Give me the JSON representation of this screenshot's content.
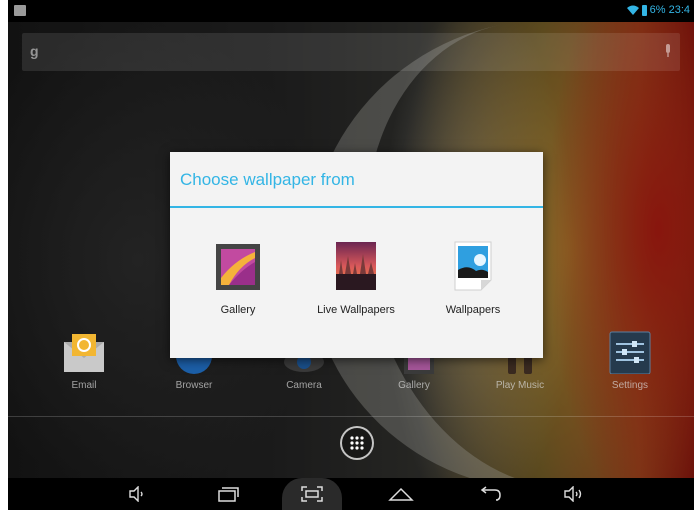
{
  "status_bar": {
    "battery_text": "6%",
    "time": "23:4"
  },
  "search": {
    "google_glyph": "g",
    "mic_icon": "mic-icon"
  },
  "dock": {
    "items": [
      {
        "label": "Email",
        "icon": "email-icon"
      },
      {
        "label": "Browser",
        "icon": "browser-icon"
      },
      {
        "label": "Camera",
        "icon": "camera-icon"
      },
      {
        "label": "Gallery",
        "icon": "gallery-icon"
      },
      {
        "label": "Play Music",
        "icon": "headphones-icon"
      },
      {
        "label": "Settings",
        "icon": "settings-icon"
      }
    ]
  },
  "dialog": {
    "title": "Choose wallpaper from",
    "options": [
      {
        "label": "Gallery",
        "icon": "gallery-icon"
      },
      {
        "label": "Live Wallpapers",
        "icon": "live-wallpapers-icon"
      },
      {
        "label": "Wallpapers",
        "icon": "wallpapers-icon"
      }
    ]
  },
  "nav": {
    "buttons": [
      "volume-down-icon",
      "recent-apps-icon",
      "screenshot-icon",
      "home-icon",
      "back-icon",
      "volume-up-icon"
    ]
  },
  "colors": {
    "accent": "#33b5e5",
    "dialog_bg": "#f3f3f3"
  }
}
